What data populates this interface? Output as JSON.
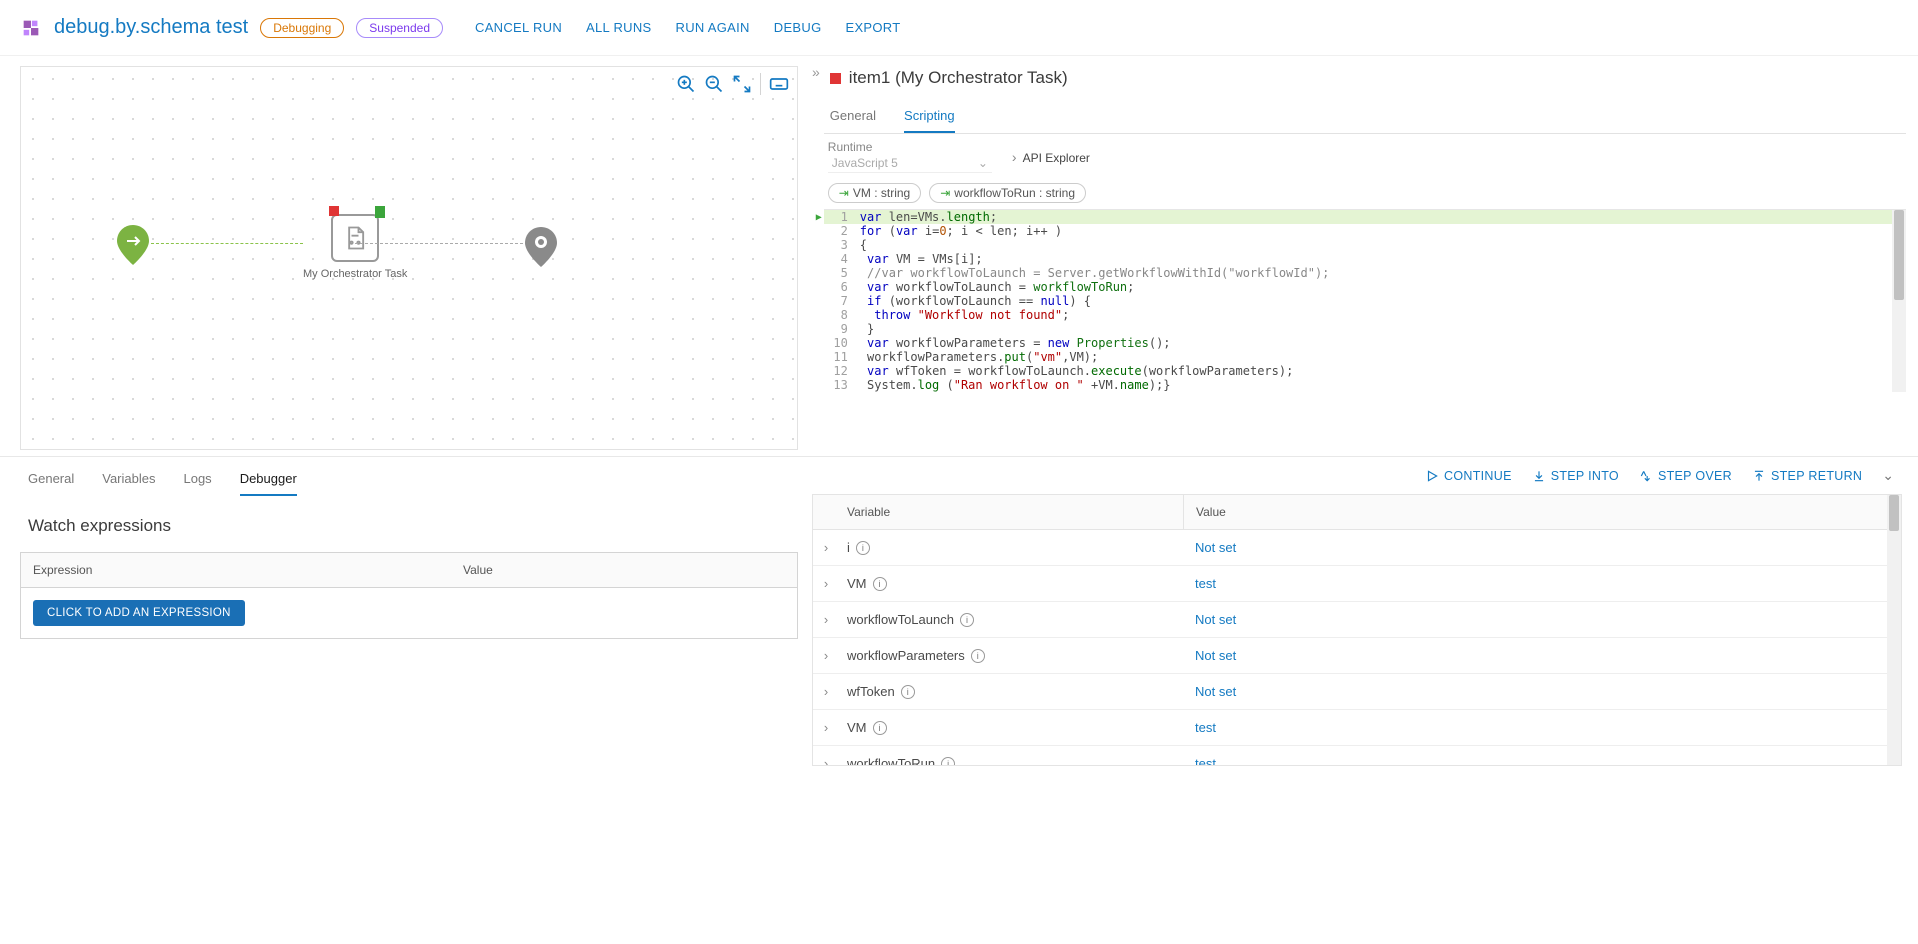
{
  "header": {
    "title": "debug.by.schema test",
    "badge_debugging": "Debugging",
    "badge_suspended": "Suspended",
    "actions": {
      "cancel_run": "CANCEL RUN",
      "all_runs": "ALL RUNS",
      "run_again": "RUN AGAIN",
      "debug": "DEBUG",
      "export": "EXPORT"
    }
  },
  "canvas": {
    "task_label": "My Orchestrator Task"
  },
  "detail": {
    "item_title": "item1 (My Orchestrator Task)",
    "tabs": {
      "general": "General",
      "scripting": "Scripting"
    },
    "runtime_label": "Runtime",
    "runtime_value": "JavaScript 5",
    "api_explorer": "API Explorer",
    "params": {
      "vm": "VM : string",
      "workflow": "workflowToRun : string"
    }
  },
  "bottom_left": {
    "tabs": {
      "general": "General",
      "variables": "Variables",
      "logs": "Logs",
      "debugger": "Debugger"
    },
    "watch_heading": "Watch expressions",
    "expr_col": "Expression",
    "value_col": "Value",
    "add_btn": "CLICK TO ADD AN EXPRESSION"
  },
  "debug_actions": {
    "continue": "CONTINUE",
    "step_into": "STEP INTO",
    "step_over": "STEP OVER",
    "step_return": "STEP RETURN"
  },
  "var_table": {
    "col_variable": "Variable",
    "col_value": "Value",
    "rows": [
      {
        "name": "i",
        "value": "Not set"
      },
      {
        "name": "VM",
        "value": "test"
      },
      {
        "name": "workflowToLaunch",
        "value": "Not set"
      },
      {
        "name": "workflowParameters",
        "value": "Not set"
      },
      {
        "name": "wfToken",
        "value": "Not set"
      },
      {
        "name": "VM",
        "value": "test"
      },
      {
        "name": "workflowToRun",
        "value": "test"
      }
    ]
  }
}
